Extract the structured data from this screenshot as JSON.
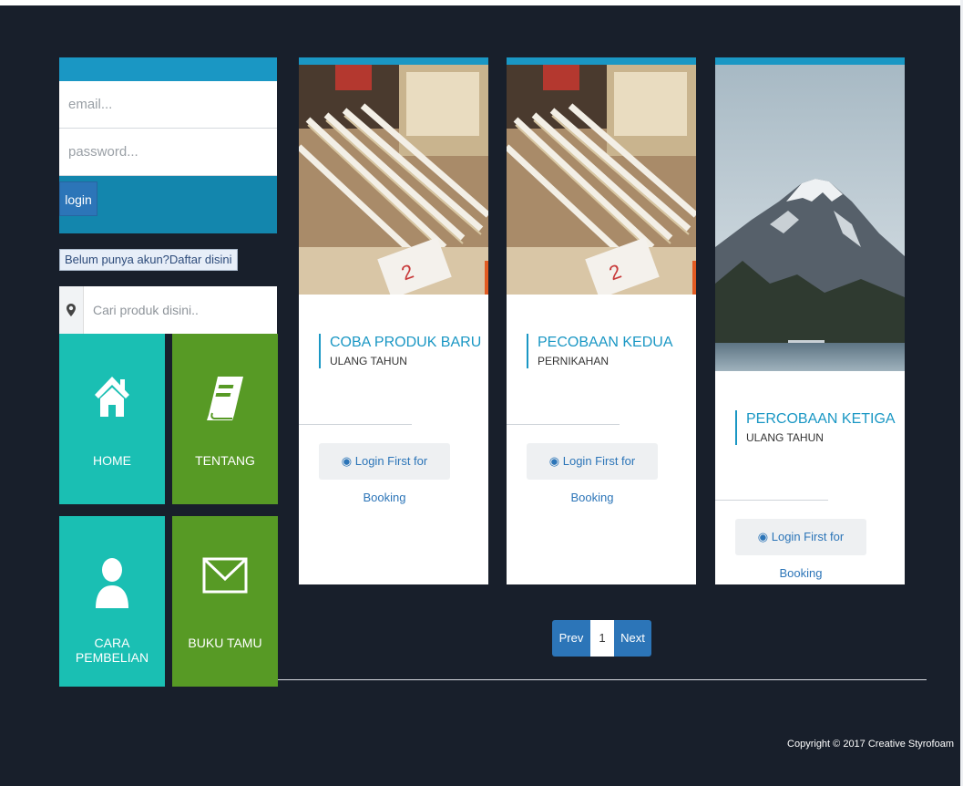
{
  "login": {
    "email_placeholder": "email...",
    "password_placeholder": "password...",
    "login_label": "login"
  },
  "register_label": "Belum punya akun?Daftar disini",
  "search": {
    "placeholder": "Cari produk disini.."
  },
  "tiles": [
    {
      "label": "HOME",
      "icon": "home-icon"
    },
    {
      "label": "TENTANG",
      "icon": "book-icon"
    },
    {
      "label": "CARA PEMBELIAN",
      "icon": "user-icon"
    },
    {
      "label": "BUKU TAMU",
      "icon": "envelope-icon"
    }
  ],
  "cards": [
    {
      "title": "COBA PRODUK BARU",
      "subtitle": "ULANG TAHUN",
      "button": "Login First for Booking",
      "image": "rulers-photo"
    },
    {
      "title": "PECOBAAN KEDUA",
      "subtitle": "PERNIKAHAN",
      "button": "Login First for Booking",
      "image": "rulers-photo"
    },
    {
      "title": "PERCOBAAN KETIGA",
      "subtitle": "ULANG TAHUN",
      "button": "Login First for Booking",
      "image": "mountain-photo"
    }
  ],
  "pagination": {
    "prev": "Prev",
    "page": "1",
    "next": "Next"
  },
  "footer": {
    "copyright": "Copyright © 2017 Creative Styrofoam"
  },
  "colors": {
    "background": "#181f2b",
    "accent": "#1a97c4",
    "teal": "#1abfb3",
    "green": "#579a25",
    "primary": "#2c75b8"
  }
}
